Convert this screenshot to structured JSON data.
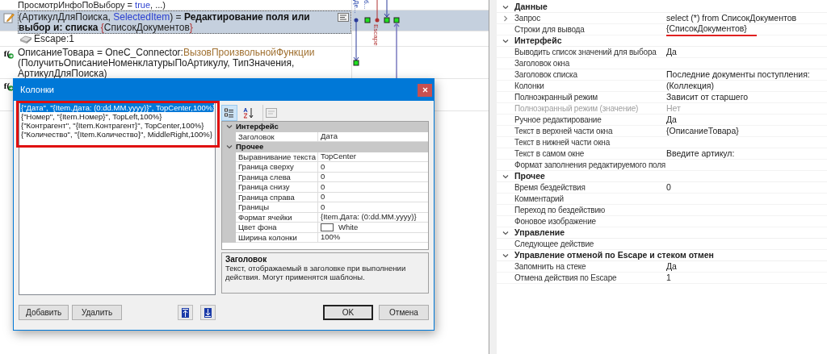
{
  "editor": {
    "lines": [
      {
        "kind": "cut",
        "selected": false,
        "segments": [
          {
            "text": "ПросмотрИнфоПоВыбору = ",
            "kind": "plain"
          },
          {
            "text": "true",
            "kind": "keyword"
          },
          {
            "text": ", ...)",
            "kind": "plain"
          }
        ]
      },
      {
        "kind": "edit",
        "selected": true,
        "segments": [
          {
            "text": "(АртикулДляПоиска, ",
            "kind": "plain"
          },
          {
            "text": "SelectedItem",
            "kind": "keyword"
          },
          {
            "text": ") = ",
            "kind": "plain"
          },
          {
            "text": "Редактирование поля или выбор и:",
            "kind": "bold"
          },
          {
            "text": " списка",
            "kind": "bold"
          },
          {
            "text": " {",
            "kind": "brace"
          },
          {
            "text": "СписокДокументов",
            "kind": "plain"
          },
          {
            "text": "}",
            "kind": "brace"
          }
        ]
      },
      {
        "kind": "escape",
        "selected": false,
        "segments": [
          {
            "text": "Escape:1",
            "kind": "plain"
          }
        ]
      },
      {
        "kind": "function",
        "selected": false,
        "icon_text": "f(",
        "segments": [
          {
            "text": "ОписаниеТовара = OneC_Connector:",
            "kind": "plain"
          },
          {
            "text": "ВызовПроизвольнойФункции",
            "kind": "method"
          },
          {
            "text": " (ПолучитьОписаниеНоменклатурыПоАртикулу, ТипЗначения, АртикулДляПоиска)",
            "kind": "plain"
          }
        ]
      },
      {
        "kind": "function",
        "selected": false,
        "icon_text": "f("
      }
    ],
    "connector_labels": [
      {
        "text": "Де...",
        "kind": "link"
      },
      {
        "text": "б...",
        "kind": "link"
      },
      {
        "text": "Escape",
        "kind": "escape"
      }
    ]
  },
  "dialog": {
    "title": "Колонки",
    "columns": [
      {
        "text": "{\"Дата\", \"{Item.Дата: (0:dd.MM.yyyy)}\", TopCenter,100%}",
        "selected": true
      },
      {
        "text": "{\"Номер\", \"{Item.Номер}\", TopLeft,100%}",
        "selected": false
      },
      {
        "text": "{\"Контрагент\", \"{Item.Контрагент}\", TopCenter,100%}",
        "selected": false
      },
      {
        "text": "{\"Количество\", \"{Item.Количество}\", MiddleRight,100%}",
        "selected": false
      }
    ],
    "groups": [
      {
        "title": "Интерфейс",
        "expanded": true,
        "rows": [
          {
            "name": "Заголовок",
            "value": "Дата",
            "kind": "text"
          }
        ]
      },
      {
        "title": "Прочее",
        "expanded": true,
        "rows": [
          {
            "name": "Выравнивание текста",
            "value": "TopCenter",
            "kind": "text"
          },
          {
            "name": "Граница сверху",
            "value": "0",
            "kind": "text"
          },
          {
            "name": "Граница слева",
            "value": "0",
            "kind": "text"
          },
          {
            "name": "Граница снизу",
            "value": "0",
            "kind": "text"
          },
          {
            "name": "Граница справа",
            "value": "0",
            "kind": "text"
          },
          {
            "name": "Границы",
            "value": "0",
            "kind": "text"
          },
          {
            "name": "Формат ячейки",
            "value": "{Item.Дата: (0:dd.MM.yyyy)}",
            "kind": "text"
          },
          {
            "name": "Цвет фона",
            "value": "White",
            "kind": "color"
          },
          {
            "name": "Ширина колонки",
            "value": "100%",
            "kind": "text"
          }
        ]
      }
    ],
    "description": {
      "title": "Заголовок",
      "text": "Текст, отображаемый в заголовке при выполнении действия. Могут применятся шаблоны."
    },
    "buttons": [
      {
        "label": "Добавить",
        "default": false
      },
      {
        "label": "Удалить",
        "default": false
      }
    ],
    "footer_buttons": [
      {
        "label": "OK",
        "default": true
      },
      {
        "label": "Отмена",
        "default": false
      }
    ]
  },
  "properties": {
    "groups": [
      {
        "title": "Данные",
        "expanded": true,
        "rows": [
          {
            "name": "Запрос",
            "value": "select (*) from СписокДокументов",
            "disabled": false,
            "expanded": false
          },
          {
            "name": "Строки для вывода",
            "value": "{СписокДокументов}",
            "disabled": false,
            "underlined": true
          }
        ]
      },
      {
        "title": "Интерфейс",
        "expanded": true,
        "rows": [
          {
            "name": "Выводить список значений для выбора",
            "value": "Да",
            "disabled": false
          },
          {
            "name": "Заголовок окна",
            "value": "",
            "disabled": false
          },
          {
            "name": "Заголовок списка",
            "value": "Последние документы поступления:",
            "disabled": false
          },
          {
            "name": "Колонки",
            "value": "(Коллекция)",
            "disabled": false
          },
          {
            "name": "Полноэкранный режим",
            "value": "Зависит от старшего",
            "disabled": false
          },
          {
            "name": "Полноэкранный режим (значение)",
            "value": "Нет",
            "disabled": true
          },
          {
            "name": "Ручное редактирование",
            "value": "Да",
            "disabled": false
          },
          {
            "name": "Текст в верхней части окна",
            "value": "{ОписаниеТовара}",
            "disabled": false
          },
          {
            "name": "Текст в нижней части окна",
            "value": "",
            "disabled": false
          },
          {
            "name": "Текст в самом окне",
            "value": "Введите артикул:",
            "disabled": false
          },
          {
            "name": "Формат заполнения редактируемого поля",
            "value": "",
            "disabled": false
          }
        ]
      },
      {
        "title": "Прочее",
        "expanded": true,
        "rows": [
          {
            "name": "Время бездействия",
            "value": "0",
            "disabled": false
          },
          {
            "name": "Комментарий",
            "value": "",
            "disabled": false
          },
          {
            "name": "Переход по бездействию",
            "value": "",
            "disabled": false
          },
          {
            "name": "Фоновое изображение",
            "value": "",
            "disabled": false
          }
        ]
      },
      {
        "title": "Управление",
        "expanded": true,
        "rows": [
          {
            "name": "Следующее действие",
            "value": "",
            "disabled": false
          }
        ]
      },
      {
        "title": "Управление отменой по Escape и стеком отмен",
        "expanded": true,
        "rows": [
          {
            "name": "Запомнить на стеке",
            "value": "Да",
            "disabled": false
          },
          {
            "name": "Отмена действия по Escape",
            "value": "1",
            "disabled": false
          }
        ]
      }
    ]
  }
}
